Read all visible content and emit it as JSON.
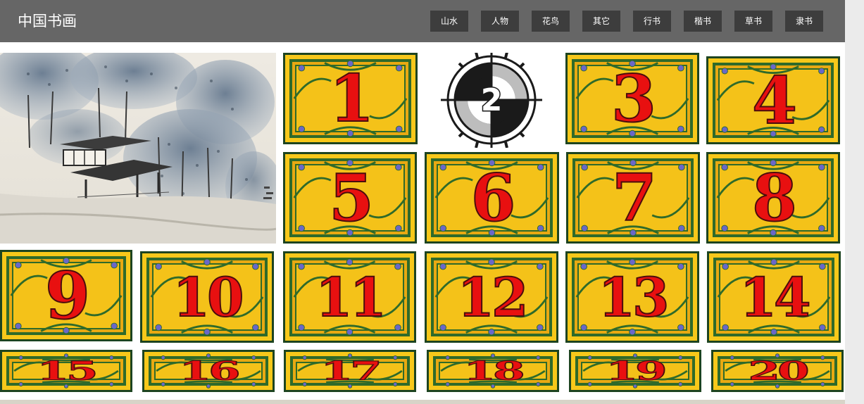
{
  "header": {
    "logo": "中国书画",
    "nav": [
      "山水",
      "人物",
      "花鸟",
      "其它",
      "行书",
      "楷书",
      "草书",
      "隶书"
    ]
  },
  "gallery": {
    "tiles": [
      "1",
      "2",
      "3",
      "4",
      "5",
      "6",
      "7",
      "8",
      "9",
      "10",
      "11",
      "12",
      "13",
      "14",
      "15",
      "16",
      "17",
      "18",
      "19",
      "20"
    ]
  },
  "colors": {
    "header_bg": "#666666",
    "nav_bg": "#3d3d3d",
    "tile_gold": "#f7c81a",
    "tile_green": "#2f6a2a",
    "numeral_red": "#e81010"
  }
}
